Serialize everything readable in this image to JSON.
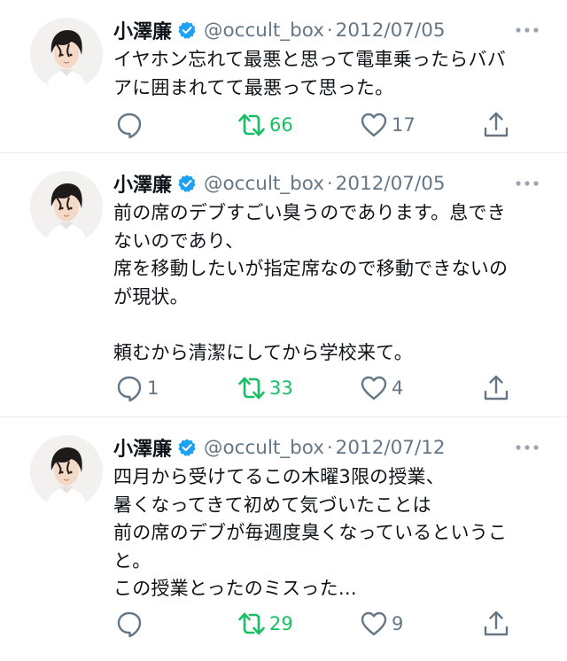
{
  "colors": {
    "text": "#0f1419",
    "muted": "#657786",
    "retweet_green": "#17bf63",
    "verified_blue": "#1da1f2",
    "divider": "#e6ecf0"
  },
  "tweets": [
    {
      "name": "小澤廉",
      "handle": "@occult_box",
      "separator": "·",
      "date": "2012/07/05",
      "text": "イヤホン忘れて最悪と思って電車乗ったらババ\nアに囲まれてて最悪って思った。",
      "replies": "",
      "retweets": "66",
      "likes": "17",
      "icons": {
        "reply": "reply-icon",
        "retweet": "retweet-icon",
        "like": "heart-icon",
        "share": "share-icon",
        "more": "more-dots-icon",
        "verified": "verified-badge-icon"
      }
    },
    {
      "name": "小澤廉",
      "handle": "@occult_box",
      "separator": "·",
      "date": "2012/07/05",
      "text": "前の席のデブすごい臭うのであります。息でき\nないのであり、\n席を移動したいが指定席なので移動できないの\nが現状。\n\n頼むから清潔にしてから学校来て。",
      "replies": "1",
      "retweets": "33",
      "likes": "4",
      "icons": {
        "reply": "reply-icon",
        "retweet": "retweet-icon",
        "like": "heart-icon",
        "share": "share-icon",
        "more": "more-dots-icon",
        "verified": "verified-badge-icon"
      }
    },
    {
      "name": "小澤廉",
      "handle": "@occult_box",
      "separator": "·",
      "date": "2012/07/12",
      "text": "四月から受けてるこの木曜3限の授業、\n暑くなってきて初めて気づいたことは\n前の席のデブが毎週度臭くなっているというこ\nと。\nこの授業とったのミスった…",
      "replies": "",
      "retweets": "29",
      "likes": "9",
      "icons": {
        "reply": "reply-icon",
        "retweet": "retweet-icon",
        "like": "heart-icon",
        "share": "share-icon",
        "more": "more-dots-icon",
        "verified": "verified-badge-icon"
      }
    }
  ]
}
